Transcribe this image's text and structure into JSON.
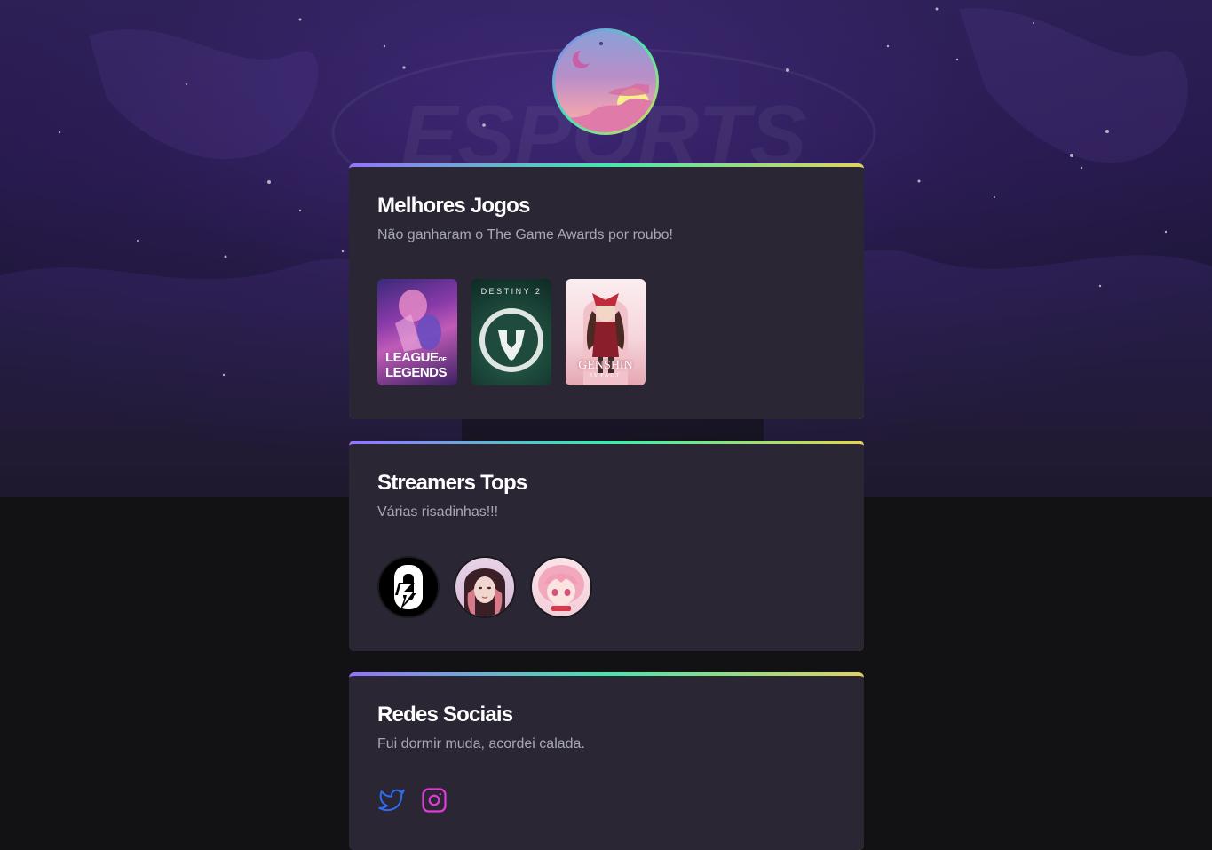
{
  "profile": {
    "avatar_icon": "night-sky-avatar-icon"
  },
  "background": {
    "watermark_text": "ESPORTS"
  },
  "cards": {
    "games": {
      "title": "Melhores Jogos",
      "subtitle": "Não ganharam o The Game Awards por roubo!",
      "items": [
        {
          "name": "League of Legends",
          "logo_line1": "LEAGUE",
          "logo_of": "OF",
          "logo_line2": "LEGENDS"
        },
        {
          "name": "Destiny 2",
          "logo": "DESTINY 2"
        },
        {
          "name": "Genshin Impact",
          "logo": "GENSHIN",
          "logo_sub": "IMPACT"
        }
      ]
    },
    "streamers": {
      "title": "Streamers Tops",
      "subtitle": "Várias risadinhas!!!",
      "items": [
        {
          "name": "streamer-1"
        },
        {
          "name": "streamer-2"
        },
        {
          "name": "streamer-3"
        }
      ]
    },
    "socials": {
      "title": "Redes Sociais",
      "subtitle": "Fui dormir muda, acordei calada.",
      "items": [
        {
          "name": "twitter",
          "icon": "twitter-icon",
          "color": "#2f6cf5"
        },
        {
          "name": "instagram",
          "icon": "instagram-icon",
          "color": "#e23ad8"
        }
      ]
    }
  },
  "colors": {
    "accent_gradient": [
      "#9572fc",
      "#43e7ad",
      "#e2d45c"
    ],
    "card_bg": "#2a2634",
    "page_bg": "#121214"
  }
}
